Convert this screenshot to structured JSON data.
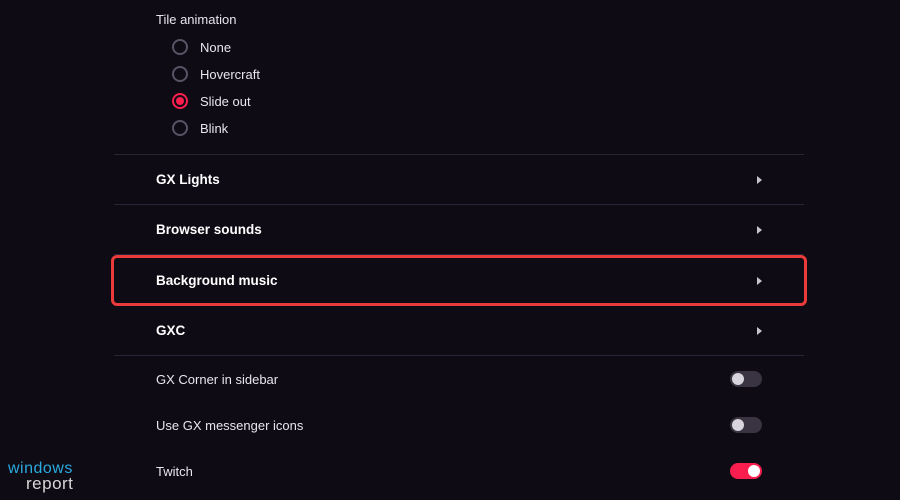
{
  "tileAnimation": {
    "title": "Tile animation",
    "options": [
      "None",
      "Hovercraft",
      "Slide out",
      "Blink"
    ],
    "selected": "Slide out"
  },
  "expandRows": [
    {
      "label": "GX Lights",
      "highlighted": false
    },
    {
      "label": "Browser sounds",
      "highlighted": false
    },
    {
      "label": "Background music",
      "highlighted": true
    },
    {
      "label": "GXC",
      "highlighted": false
    }
  ],
  "toggleRows": [
    {
      "label": "GX Corner in sidebar",
      "on": false
    },
    {
      "label": "Use GX messenger icons",
      "on": false
    },
    {
      "label": "Twitch",
      "on": true
    }
  ],
  "watermark": {
    "line1": "windows",
    "line2": "report"
  }
}
